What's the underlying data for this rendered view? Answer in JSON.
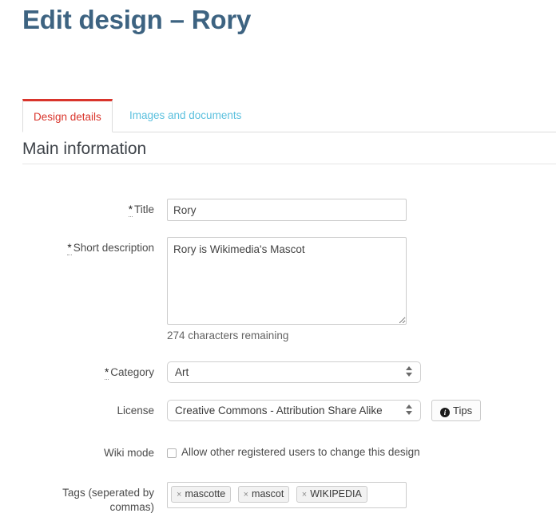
{
  "page": {
    "title": "Edit design – Rory"
  },
  "tabs": [
    {
      "label": "Design details",
      "active": true
    },
    {
      "label": "Images and documents",
      "active": false
    }
  ],
  "section": {
    "heading": "Main information"
  },
  "fields": {
    "title": {
      "required_mark": "*",
      "label": "Title",
      "value": "Rory",
      "placeholder": ""
    },
    "short_description": {
      "required_mark": "*",
      "label": "Short description",
      "value": "Rory is Wikimedia's Mascot",
      "placeholder": "",
      "help": "274 characters remaining"
    },
    "category": {
      "required_mark": "*",
      "label": "Category",
      "value": "Art"
    },
    "license": {
      "label": "License",
      "value": "Creative Commons - Attribution Share Alike",
      "tips_button": "Tips",
      "tips_icon": "info-circle-icon"
    },
    "wiki_mode": {
      "label": "Wiki mode",
      "checkbox_label": "Allow other registered users to change this design",
      "checked": false
    },
    "tags": {
      "label_line1": "Tags (seperated by",
      "label_line2": "commas)",
      "chips": [
        {
          "remove": "×",
          "text": "mascotte"
        },
        {
          "remove": "×",
          "text": "mascot"
        },
        {
          "remove": "×",
          "text": "WIKIPEDIA"
        }
      ]
    }
  },
  "colors": {
    "title": "#3d6381",
    "accent_red": "#d9342b",
    "link_blue": "#5bc0de",
    "border": "#cccccc"
  }
}
